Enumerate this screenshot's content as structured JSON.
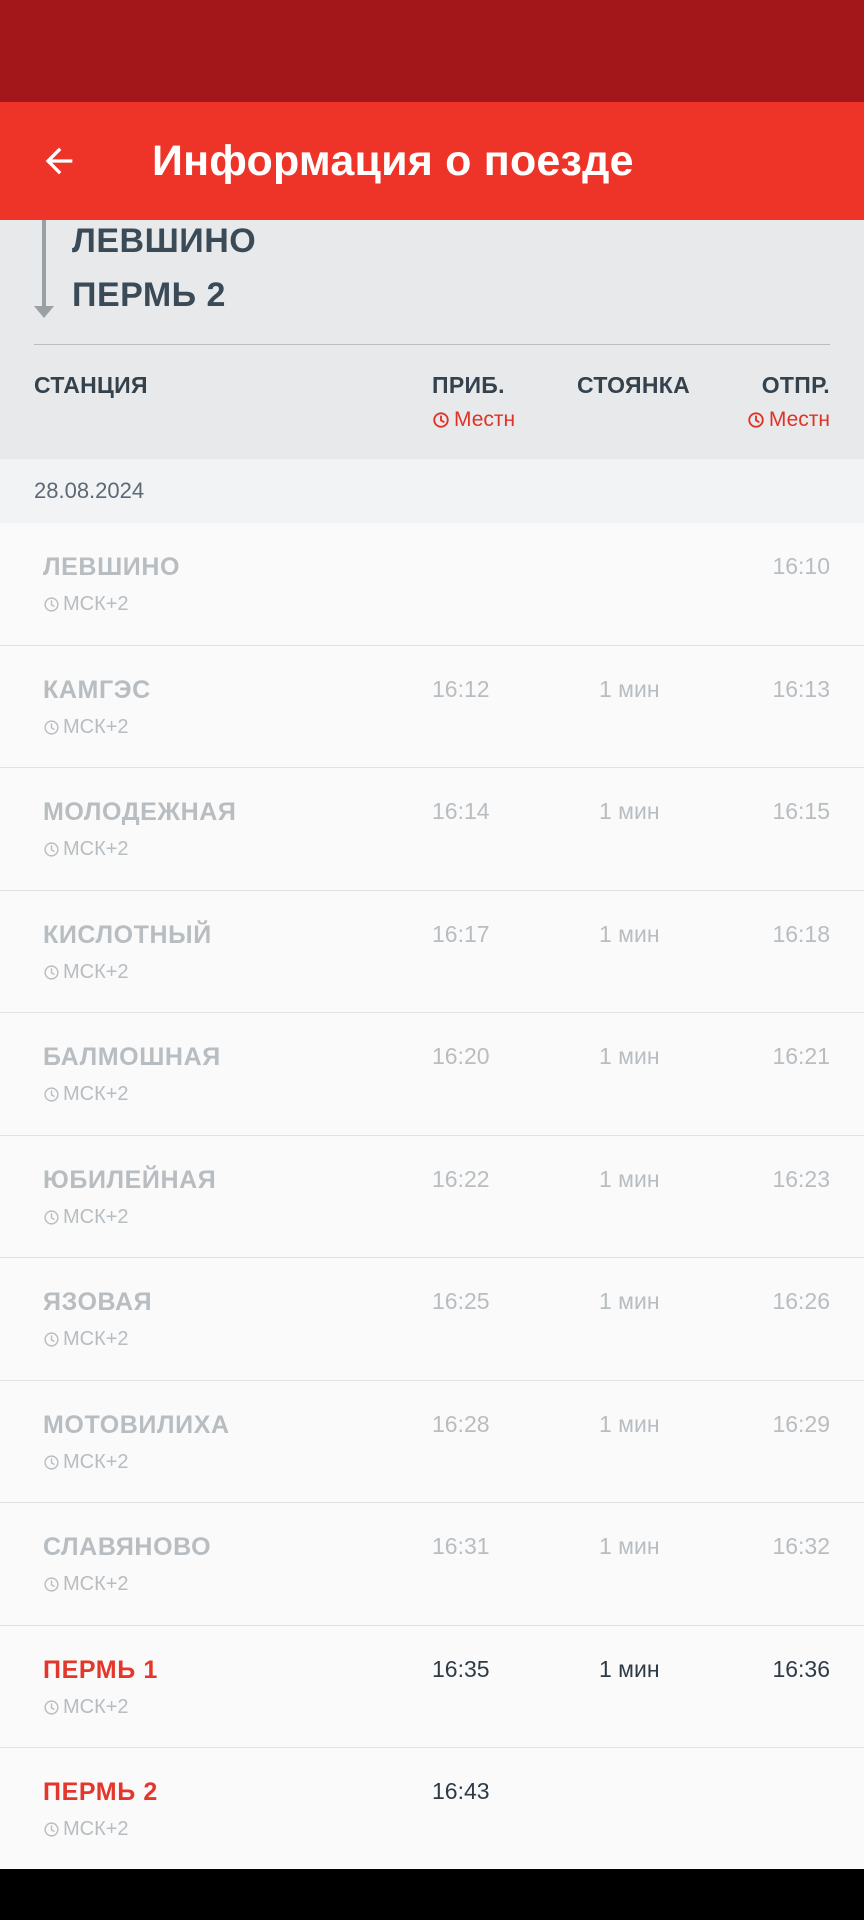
{
  "app_bar": {
    "title": "Информация о поезде"
  },
  "route": {
    "from": "ЛЕВШИНО",
    "to": "ПЕРМЬ 2"
  },
  "columns": {
    "station": "СТАНЦИЯ",
    "arrival": "ПРИБ.",
    "stop": "СТОЯНКА",
    "departure": "ОТПР.",
    "arrival_tz": "Местн",
    "departure_tz": "Местн"
  },
  "date": "28.08.2024",
  "stations": [
    {
      "name": "ЛЕВШИНО",
      "tz": "МСК+2",
      "arrival": "",
      "stop": "",
      "departure": "16:10",
      "active": false
    },
    {
      "name": "КАМГЭС",
      "tz": "МСК+2",
      "arrival": "16:12",
      "stop": "1 мин",
      "departure": "16:13",
      "active": false
    },
    {
      "name": "МОЛОДЕЖНАЯ",
      "tz": "МСК+2",
      "arrival": "16:14",
      "stop": "1 мин",
      "departure": "16:15",
      "active": false
    },
    {
      "name": "КИСЛОТНЫЙ",
      "tz": "МСК+2",
      "arrival": "16:17",
      "stop": "1 мин",
      "departure": "16:18",
      "active": false
    },
    {
      "name": "БАЛМОШНАЯ",
      "tz": "МСК+2",
      "arrival": "16:20",
      "stop": "1 мин",
      "departure": "16:21",
      "active": false
    },
    {
      "name": "ЮБИЛЕЙНАЯ",
      "tz": "МСК+2",
      "arrival": "16:22",
      "stop": "1 мин",
      "departure": "16:23",
      "active": false
    },
    {
      "name": "ЯЗОВАЯ",
      "tz": "МСК+2",
      "arrival": "16:25",
      "stop": "1 мин",
      "departure": "16:26",
      "active": false
    },
    {
      "name": "МОТОВИЛИХА",
      "tz": "МСК+2",
      "arrival": "16:28",
      "stop": "1 мин",
      "departure": "16:29",
      "active": false
    },
    {
      "name": "СЛАВЯНОВО",
      "tz": "МСК+2",
      "arrival": "16:31",
      "stop": "1 мин",
      "departure": "16:32",
      "active": false
    },
    {
      "name": "ПЕРМЬ 1",
      "tz": "МСК+2",
      "arrival": "16:35",
      "stop": "1 мин",
      "departure": "16:36",
      "active": true
    },
    {
      "name": "ПЕРМЬ 2",
      "tz": "МСК+2",
      "arrival": "16:43",
      "stop": "",
      "departure": "",
      "active": true
    }
  ],
  "colors": {
    "status_bar": "#a3161a",
    "app_bar": "#ee3428",
    "accent_red": "#e5362b",
    "inactive_text": "#b8bdc1",
    "active_text": "#2e3b46"
  },
  "icons": {
    "back": "arrow-left-icon",
    "clock": "clock-icon",
    "route_arrow": "arrow-down-icon"
  }
}
